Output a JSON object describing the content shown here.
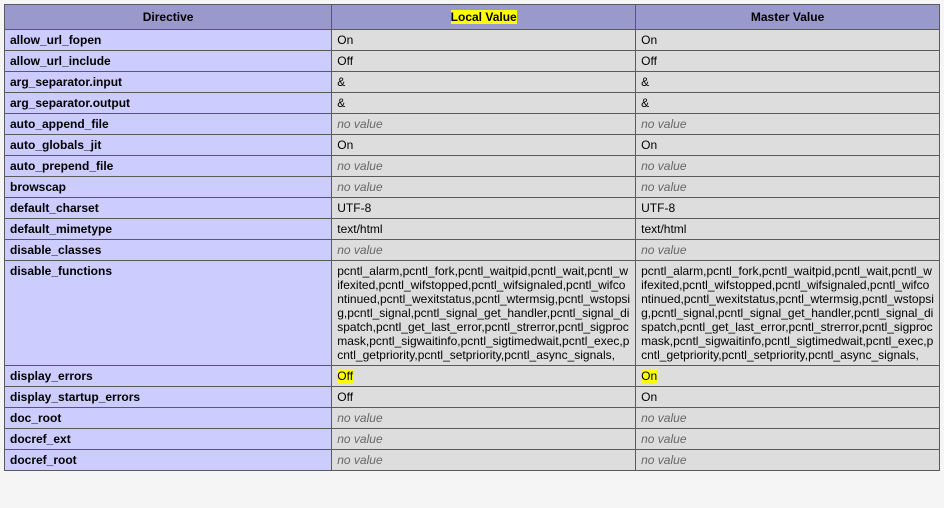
{
  "header": {
    "directive": "Directive",
    "local": "Local Value",
    "master": "Master Value"
  },
  "rows": [
    {
      "name": "allow_url_fopen",
      "local": "On",
      "master": "On",
      "lno": false,
      "mno": false,
      "lhl": false,
      "mhl": false
    },
    {
      "name": "allow_url_include",
      "local": "Off",
      "master": "Off",
      "lno": false,
      "mno": false,
      "lhl": false,
      "mhl": false
    },
    {
      "name": "arg_separator.input",
      "local": "&",
      "master": "&",
      "lno": false,
      "mno": false,
      "lhl": false,
      "mhl": false
    },
    {
      "name": "arg_separator.output",
      "local": "&",
      "master": "&",
      "lno": false,
      "mno": false,
      "lhl": false,
      "mhl": false
    },
    {
      "name": "auto_append_file",
      "local": "no value",
      "master": "no value",
      "lno": true,
      "mno": true,
      "lhl": false,
      "mhl": false
    },
    {
      "name": "auto_globals_jit",
      "local": "On",
      "master": "On",
      "lno": false,
      "mno": false,
      "lhl": false,
      "mhl": false
    },
    {
      "name": "auto_prepend_file",
      "local": "no value",
      "master": "no value",
      "lno": true,
      "mno": true,
      "lhl": false,
      "mhl": false
    },
    {
      "name": "browscap",
      "local": "no value",
      "master": "no value",
      "lno": true,
      "mno": true,
      "lhl": false,
      "mhl": false
    },
    {
      "name": "default_charset",
      "local": "UTF-8",
      "master": "UTF-8",
      "lno": false,
      "mno": false,
      "lhl": false,
      "mhl": false
    },
    {
      "name": "default_mimetype",
      "local": "text/html",
      "master": "text/html",
      "lno": false,
      "mno": false,
      "lhl": false,
      "mhl": false
    },
    {
      "name": "disable_classes",
      "local": "no value",
      "master": "no value",
      "lno": true,
      "mno": true,
      "lhl": false,
      "mhl": false
    },
    {
      "name": "disable_functions",
      "local": "pcntl_alarm,pcntl_fork,pcntl_waitpid,pcntl_wait,pcntl_wifexited,pcntl_wifstopped,pcntl_wifsignaled,pcntl_wifcontinued,pcntl_wexitstatus,pcntl_wtermsig,pcntl_wstopsig,pcntl_signal,pcntl_signal_get_handler,pcntl_signal_dispatch,pcntl_get_last_error,pcntl_strerror,pcntl_sigprocmask,pcntl_sigwaitinfo,pcntl_sigtimedwait,pcntl_exec,pcntl_getpriority,pcntl_setpriority,pcntl_async_signals,",
      "master": "pcntl_alarm,pcntl_fork,pcntl_waitpid,pcntl_wait,pcntl_wifexited,pcntl_wifstopped,pcntl_wifsignaled,pcntl_wifcontinued,pcntl_wexitstatus,pcntl_wtermsig,pcntl_wstopsig,pcntl_signal,pcntl_signal_get_handler,pcntl_signal_dispatch,pcntl_get_last_error,pcntl_strerror,pcntl_sigprocmask,pcntl_sigwaitinfo,pcntl_sigtimedwait,pcntl_exec,pcntl_getpriority,pcntl_setpriority,pcntl_async_signals,",
      "lno": false,
      "mno": false,
      "lhl": false,
      "mhl": false
    },
    {
      "name": "display_errors",
      "local": "Off",
      "master": "On",
      "lno": false,
      "mno": false,
      "lhl": true,
      "mhl": true
    },
    {
      "name": "display_startup_errors",
      "local": "Off",
      "master": "On",
      "lno": false,
      "mno": false,
      "lhl": false,
      "mhl": false
    },
    {
      "name": "doc_root",
      "local": "no value",
      "master": "no value",
      "lno": true,
      "mno": true,
      "lhl": false,
      "mhl": false
    },
    {
      "name": "docref_ext",
      "local": "no value",
      "master": "no value",
      "lno": true,
      "mno": true,
      "lhl": false,
      "mhl": false
    },
    {
      "name": "docref_root",
      "local": "no value",
      "master": "no value",
      "lno": true,
      "mno": true,
      "lhl": false,
      "mhl": false
    }
  ],
  "header_highlight_local": true
}
